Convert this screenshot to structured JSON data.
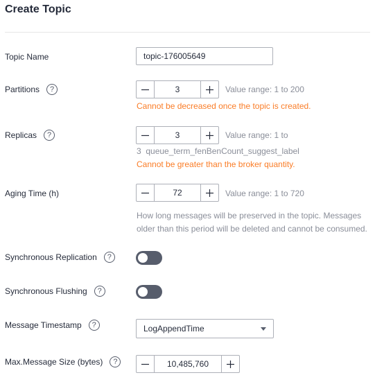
{
  "page": {
    "title": "Create Topic"
  },
  "form": {
    "topic_name": {
      "label": "Topic Name",
      "value": "topic-176005649"
    },
    "partitions": {
      "label": "Partitions",
      "help": "?",
      "value": "3",
      "hint": "Value range: 1 to 200",
      "warning": "Cannot be decreased once the topic is created."
    },
    "replicas": {
      "label": "Replicas",
      "help": "?",
      "value": "3",
      "hint": "Value range: 1 to",
      "hint_line2": "3  queue_term_fenBenCount_suggest_label",
      "warning": "Cannot be greater than the broker quantity."
    },
    "aging_time": {
      "label": "Aging Time (h)",
      "value": "72",
      "hint": "Value range: 1 to 720",
      "description": "How long messages will be preserved in the topic. Messages older than this period will be deleted and cannot be consumed."
    },
    "sync_replication": {
      "label": "Synchronous Replication",
      "help": "?",
      "enabled": false
    },
    "sync_flushing": {
      "label": "Synchronous Flushing",
      "help": "?",
      "enabled": false
    },
    "message_timestamp": {
      "label": "Message Timestamp",
      "help": "?",
      "value": "LogAppendTime"
    },
    "max_message_size": {
      "label": "Max.Message Size (bytes)",
      "help": "?",
      "value": "10,485,760"
    }
  },
  "colors": {
    "warning": "#fa7c26",
    "toggle_off": "#575d6c",
    "hint": "#8a8e99"
  }
}
